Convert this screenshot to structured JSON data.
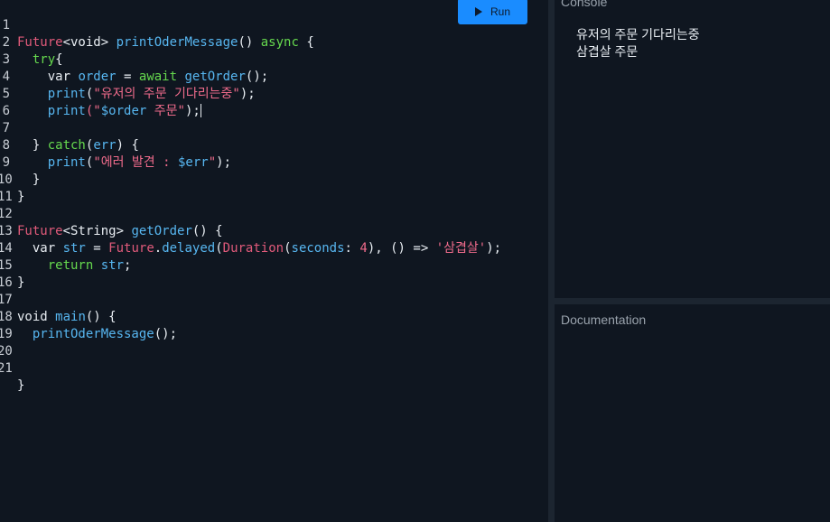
{
  "toolbar": {
    "run_label": "Run"
  },
  "editor": {
    "lines": [
      {
        "n": "1"
      },
      {
        "n": "2"
      },
      {
        "n": "3"
      },
      {
        "n": "4"
      },
      {
        "n": "5"
      },
      {
        "n": "6"
      },
      {
        "n": "7"
      },
      {
        "n": "8"
      },
      {
        "n": "9"
      },
      {
        "n": "10"
      },
      {
        "n": "11"
      },
      {
        "n": "12"
      },
      {
        "n": "13"
      },
      {
        "n": "14"
      },
      {
        "n": "15"
      },
      {
        "n": "16"
      },
      {
        "n": "17"
      },
      {
        "n": "18"
      },
      {
        "n": "19"
      },
      {
        "n": "20"
      },
      {
        "n": "21"
      }
    ],
    "code": {
      "l1": {
        "a": "Future",
        "b": "<void> ",
        "c": "printOderMessage",
        "d": "() ",
        "e": "async",
        "f": " {"
      },
      "l2": {
        "a": "try",
        "b": "{"
      },
      "l3": {
        "a": "var ",
        "b": "order",
        "c": " = ",
        "d": "await ",
        "e": "getOrder",
        "f": "();"
      },
      "l4": {
        "a": "print",
        "b": "(",
        "c": "\"유저의 주문 기다리는중\"",
        "d": ");"
      },
      "l5": {
        "a": "print",
        "b": "(\"",
        "c": "$order",
        "d": " 주문\"",
        "e": ");"
      },
      "l7": {
        "a": "} ",
        "b": "catch",
        "c": "(",
        "d": "err",
        "e": ") {"
      },
      "l8": {
        "a": "print",
        "b": "(",
        "c": "\"에러 발견 : ",
        "d": "$err",
        "e": "\"",
        "f": ");"
      },
      "l9": {
        "a": "}"
      },
      "l10": {
        "a": "}"
      },
      "l12": {
        "a": "Future",
        "b": "<String> ",
        "c": "getOrder",
        "d": "() {"
      },
      "l13": {
        "a": "var ",
        "b": "str",
        "c": " = ",
        "d": "Future",
        "e": ".",
        "f": "delayed",
        "g": "(",
        "h": "Duration",
        "i": "(",
        "j": "seconds",
        "k": ": ",
        "l": "4",
        "m": "), () => ",
        "n": "'삼겹살'",
        "o": ");"
      },
      "l14": {
        "a": "return ",
        "b": "str",
        "c": ";"
      },
      "l15": {
        "a": "}"
      },
      "l17": {
        "a": "void ",
        "b": "main",
        "c": "() {"
      },
      "l18": {
        "a": "printOderMessage",
        "b": "();"
      },
      "l21": {
        "a": "}"
      }
    }
  },
  "console": {
    "title": "Console",
    "output": [
      "유저의 주문 기다리는중",
      "삼겹살 주문"
    ]
  },
  "documentation": {
    "title": "Documentation"
  },
  "colors": {
    "background": "#0f1620",
    "run_button": "#1a8cff",
    "keyword_green": "#66d94e",
    "identifier_blue": "#57b6f0",
    "string_pink": "#ef6b8b"
  }
}
